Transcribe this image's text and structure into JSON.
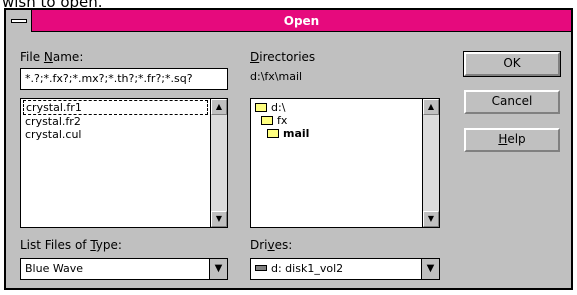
{
  "caption": "wish to open.",
  "window": {
    "title": "Open"
  },
  "file_name": {
    "label_pre": "File ",
    "label_key": "N",
    "label_post": "ame:",
    "value": "*.?;*.fx?;*.mx?;*.th?;*.fr?;*.sq?",
    "files": [
      "crystal.fr1",
      "crystal.fr2",
      "crystal.cul"
    ]
  },
  "directories": {
    "label_key": "D",
    "label_post": "irectories",
    "current": "d:\\fx\\mail",
    "items": [
      "d:\\",
      "fx",
      "mail"
    ]
  },
  "file_type": {
    "label_pre": "List Files of ",
    "label_key": "T",
    "label_post": "ype:",
    "value": "Blue Wave"
  },
  "drives": {
    "label_pre": "Dri",
    "label_key": "v",
    "label_post": "es:",
    "value": "d: disk1_vol2"
  },
  "buttons": {
    "ok": "OK",
    "cancel": "Cancel",
    "help_key": "H",
    "help_rest": "elp"
  },
  "scroll": {
    "up_glyph": "▲",
    "down_glyph": "▼",
    "drop_glyph": "▼"
  },
  "colors": {
    "titlebar": "#e60a7d",
    "face": "#c0c0c0"
  }
}
